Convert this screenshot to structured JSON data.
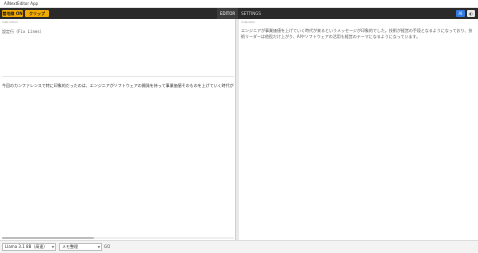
{
  "window": {
    "title": "AiNextEditor App"
  },
  "toolbar": {
    "button1_label": "着地線 ON",
    "button2_label": "クリップ ON",
    "tabs": [
      {
        "label": "EDITOR",
        "active": true
      },
      {
        "label": "SETTINGS",
        "active": false
      }
    ],
    "ai_badge": "AI",
    "toggle_label": "◐"
  },
  "left_pane": {
    "label": "instruction",
    "settings_text": "設定行（Fix Lines）",
    "editor_line": "今回のカンファレンスで特に印象的だったのは、エンジニアがソフトウェアの開発を持って事業価値そのものを上げていく時代がきているというメッセージでした。"
  },
  "right_pane": {
    "label": "output/ai",
    "response": "エンジニアが事業価値を上げていく時代が来るというメッセージが印象的でした。技術が経営の手段となるようになっており、技術リーダーは他役だけ上がり、AIやソフトウェアの活用も経営のテーマになるようになっています。"
  },
  "bottom": {
    "model_select": "Llama 3.1 8B（高速）",
    "mode_select": "メモ整理",
    "go_label": "GO"
  },
  "colors": {
    "toolbar_bg": "#2a2a2a",
    "accent_yellow": "#f2a900",
    "ai_blue": "#2f7ae5"
  }
}
